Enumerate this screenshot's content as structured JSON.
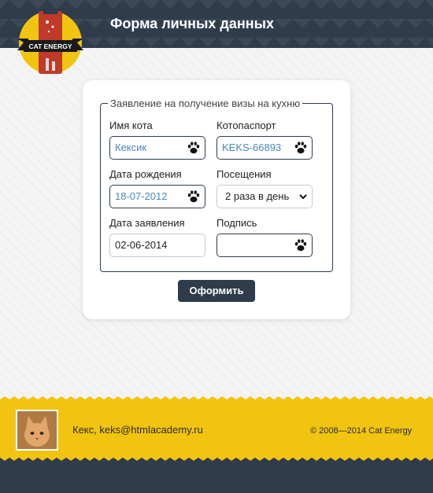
{
  "header": {
    "title": "Форма личных данных",
    "logo_text": "CAT ENERGY",
    "colors": {
      "dark": "#2f3c4b",
      "accent": "#f1c40f",
      "logo_red": "#c0392b"
    }
  },
  "form": {
    "legend": "Заявление на получение визы на кухню",
    "fields": {
      "cat_name": {
        "label": "Имя кота",
        "value": "Кексик",
        "icon": "paw-icon"
      },
      "passport": {
        "label": "Котопаспорт",
        "value": "KEKS-66893",
        "icon": "paw-icon"
      },
      "birth_date": {
        "label": "Дата рождения",
        "value": "18-07-2012",
        "icon": "paw-icon"
      },
      "visits": {
        "label": "Посещения",
        "value": "2 раза в день",
        "icon": "chevron-down-icon"
      },
      "application_date": {
        "label": "Дата заявления",
        "value": "02-06-2014"
      },
      "signature": {
        "label": "Подпись",
        "value": "",
        "icon": "paw-icon"
      }
    },
    "submit_label": "Оформить"
  },
  "footer": {
    "contact": "Кекс, keks@htmlacademy.ru",
    "copyright": "© 2008—2014 Cat Energy"
  }
}
